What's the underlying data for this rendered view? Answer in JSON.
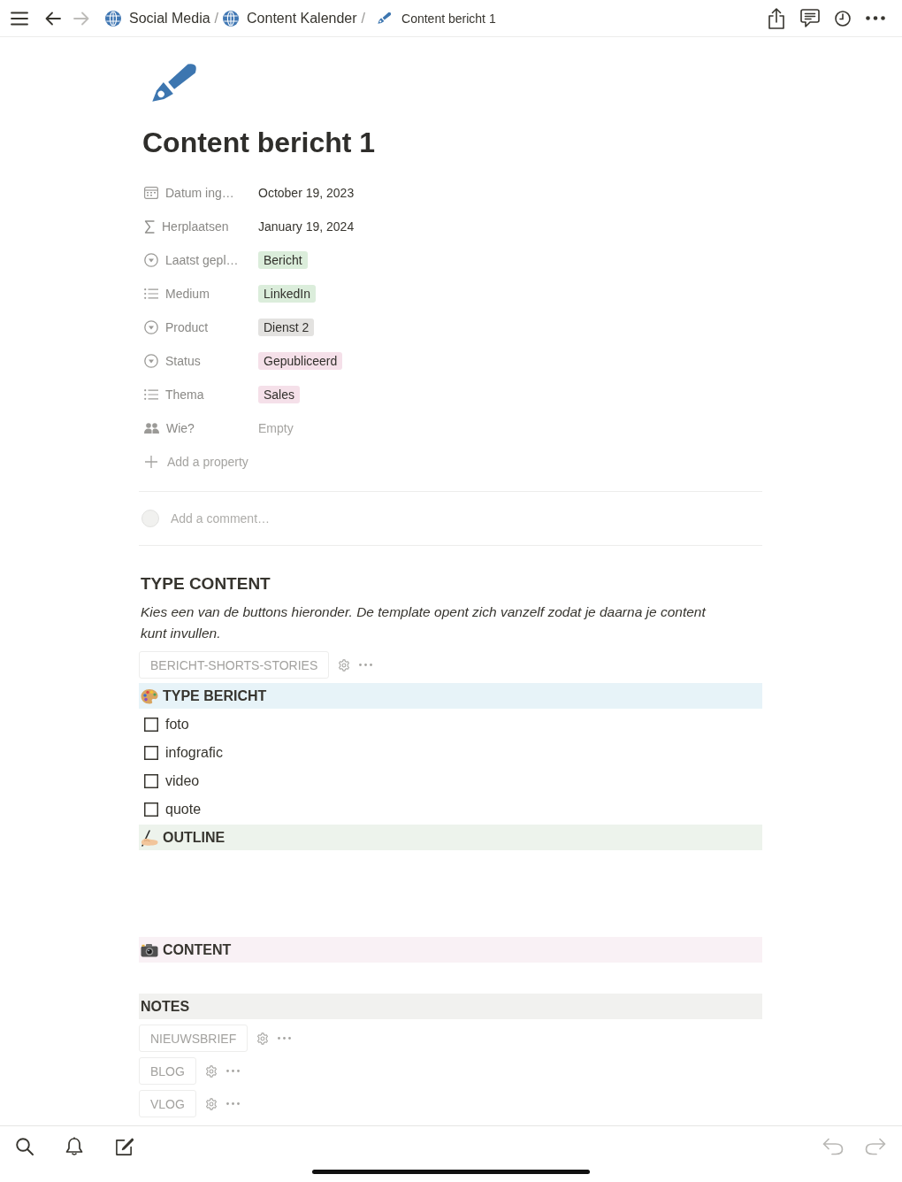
{
  "top_bar": {
    "nav_buttons": [
      {
        "kind": "menu",
        "disabled": false
      },
      {
        "kind": "back",
        "disabled": false
      },
      {
        "kind": "forward",
        "disabled": true
      }
    ],
    "breadcrumbs": [
      {
        "kind": "database",
        "label": "Social Media",
        "separator": "/"
      },
      {
        "kind": "database",
        "label": "Content Kalender",
        "separator": "/"
      },
      {
        "kind": "page",
        "label": "Content bericht 1"
      }
    ],
    "actions": [
      {
        "kind": "share"
      },
      {
        "kind": "comments"
      },
      {
        "kind": "history"
      },
      {
        "kind": "more"
      }
    ]
  },
  "page": {
    "title": "Content bericht 1",
    "properties": [
      {
        "kind": "date",
        "name": "Datum ing…",
        "value": "October 19, 2023"
      },
      {
        "kind": "formula",
        "name": "Herplaatsen",
        "value": "January 19, 2024"
      },
      {
        "kind": "select",
        "name": "Laatst gepl…",
        "tag": {
          "label": "Bericht",
          "color": "#dbeddb"
        }
      },
      {
        "kind": "multi_select",
        "name": "Medium",
        "tag": {
          "label": "LinkedIn",
          "color": "#dbeddb"
        }
      },
      {
        "kind": "select",
        "name": "Product",
        "tag": {
          "label": "Dienst 2",
          "color": "#e3e2e0"
        }
      },
      {
        "kind": "select",
        "name": "Status",
        "tag": {
          "label": "Gepubliceerd",
          "color": "#f5e0e9"
        }
      },
      {
        "kind": "multi_select",
        "name": "Thema",
        "tag": {
          "label": "Sales",
          "color": "#f5e0e9"
        }
      },
      {
        "kind": "person",
        "name": "Wie?",
        "placeholder": "Empty"
      }
    ],
    "add_property": "Add a property",
    "comment": {
      "placeholder": "Add a comment…"
    },
    "blocks": [
      {
        "kind": "heading",
        "text": "TYPE CONTENT"
      },
      {
        "kind": "paragraph",
        "text": "Kies een van de buttons hieronder. De template opent zich vanzelf zodat je daarna je content kunt invullen."
      },
      {
        "kind": "button",
        "label": "BERICHT-SHORTS-STORIES"
      },
      {
        "kind": "palette",
        "title": "TYPE BERICHT",
        "color": "#e7f3f8"
      },
      {
        "kind": "todo",
        "label": "foto",
        "checked": false
      },
      {
        "kind": "todo",
        "label": "infografic",
        "checked": false
      },
      {
        "kind": "todo",
        "label": "video",
        "checked": false
      },
      {
        "kind": "todo",
        "label": "quote",
        "checked": false
      },
      {
        "kind": "writing",
        "title": "OUTLINE",
        "color": "#edf3ec"
      },
      {
        "kind": "camera",
        "title": "CONTENT",
        "color": "#f9f1f5"
      },
      {
        "kind": "banner",
        "title": "NOTES",
        "color": "#f1f1ef"
      },
      {
        "kind": "button",
        "label": "NIEUWSBRIEF"
      },
      {
        "kind": "button",
        "label": "BLOG"
      },
      {
        "kind": "button",
        "label": "VLOG"
      }
    ]
  },
  "bottom_bar": {
    "tools": [
      {
        "kind": "search"
      },
      {
        "kind": "notifications"
      },
      {
        "kind": "compose"
      }
    ],
    "history_buttons": [
      {
        "kind": "undo",
        "disabled": true
      },
      {
        "kind": "redo",
        "disabled": true
      }
    ]
  }
}
